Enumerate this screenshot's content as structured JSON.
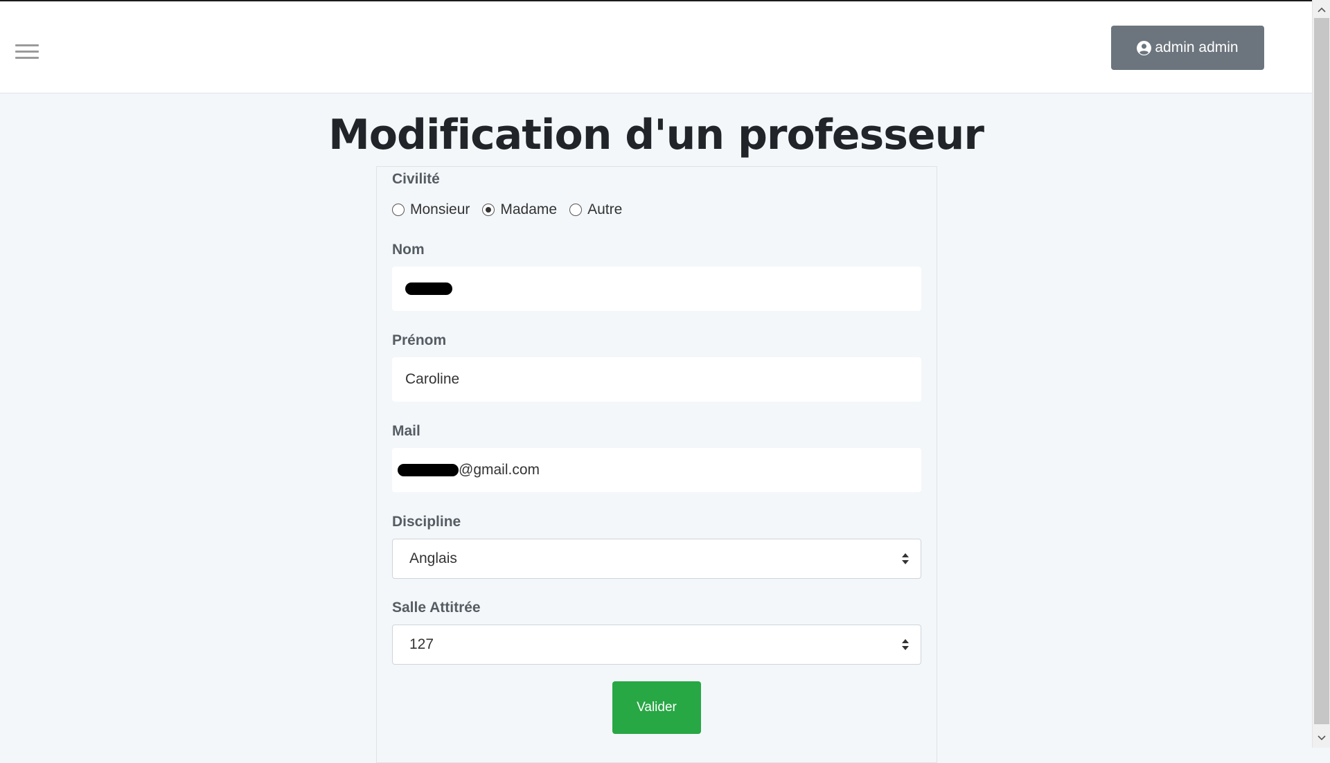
{
  "navbar": {
    "menu_icon": "hamburger-menu-icon",
    "user_icon": "user-circle-icon",
    "user_label": "admin admin"
  },
  "page": {
    "title": "Modification d'un professeur"
  },
  "form": {
    "civilite": {
      "label": "Civilité",
      "options": [
        "Monsieur",
        "Madame",
        "Autre"
      ],
      "selected": "Madame"
    },
    "nom": {
      "label": "Nom",
      "value_redacted": true
    },
    "prenom": {
      "label": "Prénom",
      "value": "Caroline"
    },
    "mail": {
      "label": "Mail",
      "value_suffix": "@gmail.com",
      "value_redacted_prefix": true
    },
    "discipline": {
      "label": "Discipline",
      "selected": "Anglais"
    },
    "salle": {
      "label": "Salle Attitrée",
      "selected": "127"
    },
    "submit_label": "Valider"
  },
  "colors": {
    "background": "#f3f7fa",
    "user_button": "#6c757d",
    "submit_button": "#28a745"
  }
}
